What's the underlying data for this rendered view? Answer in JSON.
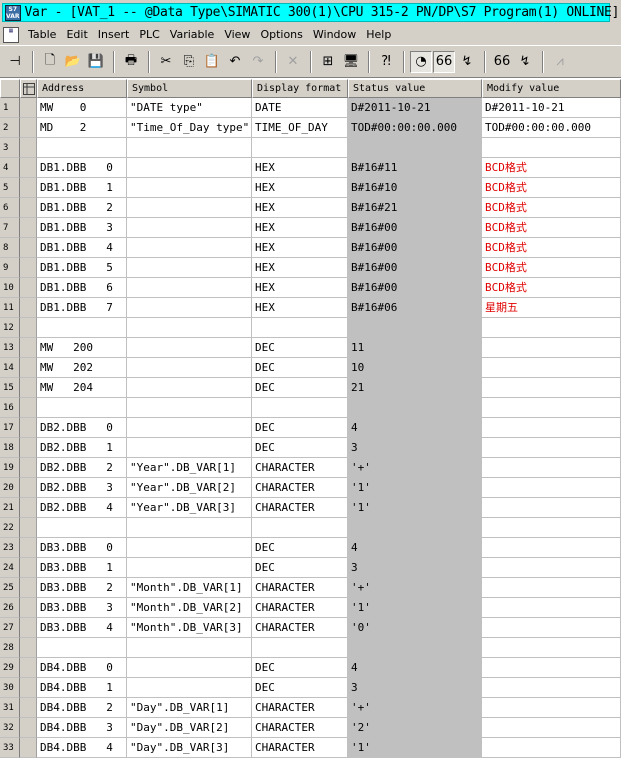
{
  "window": {
    "app_icon_text": "S7 VAR",
    "title": "Var - [VAT_1 -- @Data Type\\SIMATIC 300(1)\\CPU 315-2 PN/DP\\S7 Program(1)  ONLINE]"
  },
  "menu": [
    "Table",
    "Edit",
    "Insert",
    "PLC",
    "Variable",
    "View",
    "Options",
    "Window",
    "Help"
  ],
  "toolbar": [
    {
      "icon": "pin-icon",
      "glyph": "⊣"
    },
    {
      "sep": true
    },
    {
      "icon": "new-file-icon",
      "glyph": "🗋"
    },
    {
      "icon": "open-folder-icon",
      "glyph": "📂"
    },
    {
      "icon": "save-icon",
      "glyph": "💾"
    },
    {
      "sep": true
    },
    {
      "icon": "print-icon",
      "glyph": "🖶"
    },
    {
      "sep": true
    },
    {
      "icon": "cut-icon",
      "glyph": "✂"
    },
    {
      "icon": "copy-icon",
      "glyph": "⎘"
    },
    {
      "icon": "paste-icon",
      "glyph": "📋"
    },
    {
      "icon": "undo-icon",
      "glyph": "↶"
    },
    {
      "icon": "redo-icon",
      "glyph": "↷",
      "disabled": true
    },
    {
      "sep": true
    },
    {
      "icon": "delete-icon",
      "glyph": "✕",
      "disabled": true
    },
    {
      "sep": true
    },
    {
      "icon": "network-icon",
      "glyph": "⊞"
    },
    {
      "icon": "monitor-device-icon",
      "glyph": "🖥"
    },
    {
      "sep": true
    },
    {
      "icon": "context-help-icon",
      "glyph": "⁈"
    },
    {
      "sep": true
    },
    {
      "icon": "monitor-variable-icon",
      "glyph": "◔",
      "pressed": true
    },
    {
      "icon": "monitor-variable-once-icon",
      "glyph": "66",
      "pressed": true
    },
    {
      "icon": "modify-variable-icon",
      "glyph": "↯"
    },
    {
      "sep": true
    },
    {
      "icon": "update-monitor-values-icon",
      "glyph": "66"
    },
    {
      "icon": "activate-modify-values-icon",
      "glyph": "↯"
    },
    {
      "sep": true
    },
    {
      "icon": "force-icon",
      "glyph": "⩘",
      "disabled": true
    }
  ],
  "columns": [
    "Address",
    "Symbol",
    "Display format",
    "Status value",
    "Modify value"
  ],
  "rows": [
    {
      "n": "1",
      "addr": "MW    0",
      "sym": "\"DATE type\"",
      "fmt": "DATE",
      "status": "D#2011-10-21",
      "mod": "D#2011-10-21",
      "red": false
    },
    {
      "n": "2",
      "addr": "MD    2",
      "sym": "\"Time_Of_Day type\"",
      "fmt": "TIME_OF_DAY",
      "status": "TOD#00:00:00.000",
      "mod": "TOD#00:00:00.000",
      "red": false
    },
    {
      "n": "3",
      "addr": "",
      "sym": "",
      "fmt": "",
      "status": "",
      "mod": "",
      "red": false
    },
    {
      "n": "4",
      "addr": "DB1.DBB   0",
      "sym": "",
      "fmt": "HEX",
      "status": "B#16#11",
      "mod": "BCD格式",
      "red": true
    },
    {
      "n": "5",
      "addr": "DB1.DBB   1",
      "sym": "",
      "fmt": "HEX",
      "status": "B#16#10",
      "mod": "BCD格式",
      "red": true
    },
    {
      "n": "6",
      "addr": "DB1.DBB   2",
      "sym": "",
      "fmt": "HEX",
      "status": "B#16#21",
      "mod": "BCD格式",
      "red": true
    },
    {
      "n": "7",
      "addr": "DB1.DBB   3",
      "sym": "",
      "fmt": "HEX",
      "status": "B#16#00",
      "mod": "BCD格式",
      "red": true
    },
    {
      "n": "8",
      "addr": "DB1.DBB   4",
      "sym": "",
      "fmt": "HEX",
      "status": "B#16#00",
      "mod": "BCD格式",
      "red": true
    },
    {
      "n": "9",
      "addr": "DB1.DBB   5",
      "sym": "",
      "fmt": "HEX",
      "status": "B#16#00",
      "mod": "BCD格式",
      "red": true
    },
    {
      "n": "10",
      "addr": "DB1.DBB   6",
      "sym": "",
      "fmt": "HEX",
      "status": "B#16#00",
      "mod": "BCD格式",
      "red": true
    },
    {
      "n": "11",
      "addr": "DB1.DBB   7",
      "sym": "",
      "fmt": "HEX",
      "status": "B#16#06",
      "mod": "星期五",
      "red": true
    },
    {
      "n": "12",
      "addr": "",
      "sym": "",
      "fmt": "",
      "status": "",
      "mod": "",
      "red": false
    },
    {
      "n": "13",
      "addr": "MW   200",
      "sym": "",
      "fmt": "DEC",
      "status": "11",
      "mod": "",
      "red": false
    },
    {
      "n": "14",
      "addr": "MW   202",
      "sym": "",
      "fmt": "DEC",
      "status": "10",
      "mod": "",
      "red": false
    },
    {
      "n": "15",
      "addr": "MW   204",
      "sym": "",
      "fmt": "DEC",
      "status": "21",
      "mod": "",
      "red": false
    },
    {
      "n": "16",
      "addr": "",
      "sym": "",
      "fmt": "",
      "status": "",
      "mod": "",
      "red": false
    },
    {
      "n": "17",
      "addr": "DB2.DBB   0",
      "sym": "",
      "fmt": "DEC",
      "status": "4",
      "mod": "",
      "red": false
    },
    {
      "n": "18",
      "addr": "DB2.DBB   1",
      "sym": "",
      "fmt": "DEC",
      "status": "3",
      "mod": "",
      "red": false
    },
    {
      "n": "19",
      "addr": "DB2.DBB   2",
      "sym": "\"Year\".DB_VAR[1]",
      "fmt": "CHARACTER",
      "status": "'+'",
      "mod": "",
      "red": false
    },
    {
      "n": "20",
      "addr": "DB2.DBB   3",
      "sym": "\"Year\".DB_VAR[2]",
      "fmt": "CHARACTER",
      "status": "'1'",
      "mod": "",
      "red": false
    },
    {
      "n": "21",
      "addr": "DB2.DBB   4",
      "sym": "\"Year\".DB_VAR[3]",
      "fmt": "CHARACTER",
      "status": "'1'",
      "mod": "",
      "red": false
    },
    {
      "n": "22",
      "addr": "",
      "sym": "",
      "fmt": "",
      "status": "",
      "mod": "",
      "red": false
    },
    {
      "n": "23",
      "addr": "DB3.DBB   0",
      "sym": "",
      "fmt": "DEC",
      "status": "4",
      "mod": "",
      "red": false
    },
    {
      "n": "24",
      "addr": "DB3.DBB   1",
      "sym": "",
      "fmt": "DEC",
      "status": "3",
      "mod": "",
      "red": false
    },
    {
      "n": "25",
      "addr": "DB3.DBB   2",
      "sym": "\"Month\".DB_VAR[1]",
      "fmt": "CHARACTER",
      "status": "'+'",
      "mod": "",
      "red": false
    },
    {
      "n": "26",
      "addr": "DB3.DBB   3",
      "sym": "\"Month\".DB_VAR[2]",
      "fmt": "CHARACTER",
      "status": "'1'",
      "mod": "",
      "red": false
    },
    {
      "n": "27",
      "addr": "DB3.DBB   4",
      "sym": "\"Month\".DB_VAR[3]",
      "fmt": "CHARACTER",
      "status": "'0'",
      "mod": "",
      "red": false
    },
    {
      "n": "28",
      "addr": "",
      "sym": "",
      "fmt": "",
      "status": "",
      "mod": "",
      "red": false
    },
    {
      "n": "29",
      "addr": "DB4.DBB   0",
      "sym": "",
      "fmt": "DEC",
      "status": "4",
      "mod": "",
      "red": false
    },
    {
      "n": "30",
      "addr": "DB4.DBB   1",
      "sym": "",
      "fmt": "DEC",
      "status": "3",
      "mod": "",
      "red": false
    },
    {
      "n": "31",
      "addr": "DB4.DBB   2",
      "sym": "\"Day\".DB_VAR[1]",
      "fmt": "CHARACTER",
      "status": "'+'",
      "mod": "",
      "red": false
    },
    {
      "n": "32",
      "addr": "DB4.DBB   3",
      "sym": "\"Day\".DB_VAR[2]",
      "fmt": "CHARACTER",
      "status": "'2'",
      "mod": "",
      "red": false
    },
    {
      "n": "33",
      "addr": "DB4.DBB   4",
      "sym": "\"Day\".DB_VAR[3]",
      "fmt": "CHARACTER",
      "status": "'1'",
      "mod": "",
      "red": false
    }
  ]
}
